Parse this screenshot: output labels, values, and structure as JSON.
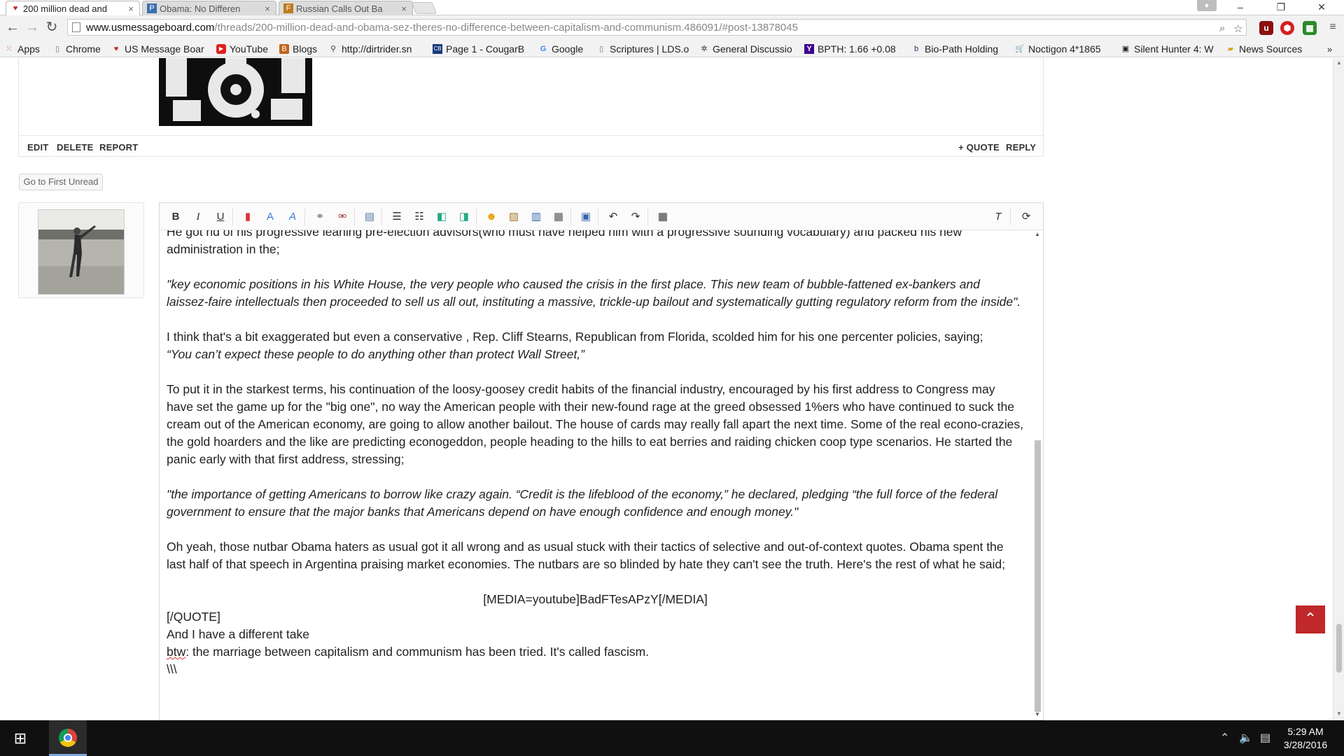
{
  "tabs": [
    {
      "title": "200 million dead and",
      "icon": "usmb-icon"
    },
    {
      "title": "Obama: No Differen",
      "icon": "pj-icon"
    },
    {
      "title": "Russian Calls Out Ba",
      "icon": "fo-icon"
    }
  ],
  "window_controls": {
    "minimize": "–",
    "restore": "❐",
    "close": "✕"
  },
  "address_bar": {
    "url_host": "www.usmessageboard.com",
    "url_path": "/threads/200-million-dead-and-obama-sez-theres-no-difference-between-capitalism-and-communism.486091/#post-13878045"
  },
  "bookmarks": [
    {
      "label": "Apps",
      "icon": "apps-grid-icon"
    },
    {
      "label": "Chrome",
      "icon": "page-icon"
    },
    {
      "label": "US Message Boar",
      "icon": "usmb-icon"
    },
    {
      "label": "YouTube",
      "icon": "youtube-icon"
    },
    {
      "label": "Blogs",
      "icon": "blogs-icon"
    },
    {
      "label": "http://dirtrider.sn",
      "icon": "dirtrider-icon"
    },
    {
      "label": "Page 1 - CougarB",
      "icon": "cougar-icon"
    },
    {
      "label": "Google",
      "icon": "google-icon"
    },
    {
      "label": "Scriptures | LDS.o",
      "icon": "page-icon"
    },
    {
      "label": "General Discussio",
      "icon": "gear-icon"
    },
    {
      "label": "BPTH: 1.66 +0.08",
      "icon": "yahoo-icon"
    },
    {
      "label": "Bio-Path Holding",
      "icon": "biopath-icon"
    },
    {
      "label": "Noctigon 4*1865",
      "icon": "cart-icon"
    },
    {
      "label": "Silent Hunter 4: W",
      "icon": "sh4-icon"
    },
    {
      "label": "News Sources",
      "icon": "folder-icon"
    }
  ],
  "post_actions": {
    "edit": "EDIT",
    "delete": "DELETE",
    "report": "REPORT",
    "quote": "+ QUOTE",
    "reply": "REPLY"
  },
  "first_unread": "Go to First Unread",
  "editor": {
    "paragraphs": [
      {
        "text": "He got rid of his progressive leaning pre-election advisors(who must have helped him with a progressive sounding vocabulary) and packed his new administration in the;",
        "style": "normal"
      },
      {
        "text": "\"key economic positions in his White House, the very people who caused the crisis in the first place. This new team of bubble-fattened ex-bankers and laissez-faire intellectuals then proceeded to sell us all out, instituting a massive, trickle-up bailout and systematically gutting regulatory reform from the inside\".",
        "style": "italic"
      },
      {
        "text": "I think that's a bit exaggerated but even a conservative , Rep. Cliff Stearns, Republican from Florida, scolded him for his one percenter policies, saying;",
        "style": "normal"
      },
      {
        "text": "“You can’t expect these people to do anything other than protect Wall Street,”",
        "style": "italic"
      },
      {
        "text": "To put it in the starkest terms, his continuation of the loosy-goosey credit habits of the financial industry, encouraged by his first address to Congress may have set the game up for the \"big one\", no way the American people with their new-found rage at the greed obsessed 1%ers who have continued to suck the cream out of the American economy, are going to allow another bailout. The house of cards may really fall apart the next time. Some of the real econo-crazies, the gold hoarders and the like are predicting econogeddon, people heading to the hills to eat berries and raiding chicken coop type scenarios. He started the panic early with that first address, stressing;",
        "style": "normal"
      },
      {
        "text": "\"the importance of getting Americans to borrow like crazy again. “Credit is the lifeblood of the economy,” he declared, pledging “the full force of the federal government to ensure that the major banks that Americans depend on have enough confidence and enough money.\"",
        "style": "italic"
      },
      {
        "text": "Oh yeah, those nutbar Obama haters as usual got it all wrong and as usual stuck with their tactics of selective and out-of-context quotes. Obama spent the last half of that speech in Argentina praising market economies. The nutbars are so blinded by hate they can't see the truth. Here's the rest of what he said;",
        "style": "normal"
      },
      {
        "text": "[MEDIA=youtube]BadFTesAPzY[/MEDIA]",
        "style": "center"
      },
      {
        "text": "[/QUOTE]",
        "style": "normal"
      },
      {
        "text": "And I have a different take",
        "style": "normal"
      },
      {
        "word": "btw",
        "text": ": the marriage between capitalism and communism has been tried. It's called fascism.",
        "style": "normal"
      },
      {
        "text": "\\\\\\",
        "style": "normal"
      }
    ]
  },
  "taskbar": {
    "time": "5:29 AM",
    "date": "3/28/2016"
  }
}
